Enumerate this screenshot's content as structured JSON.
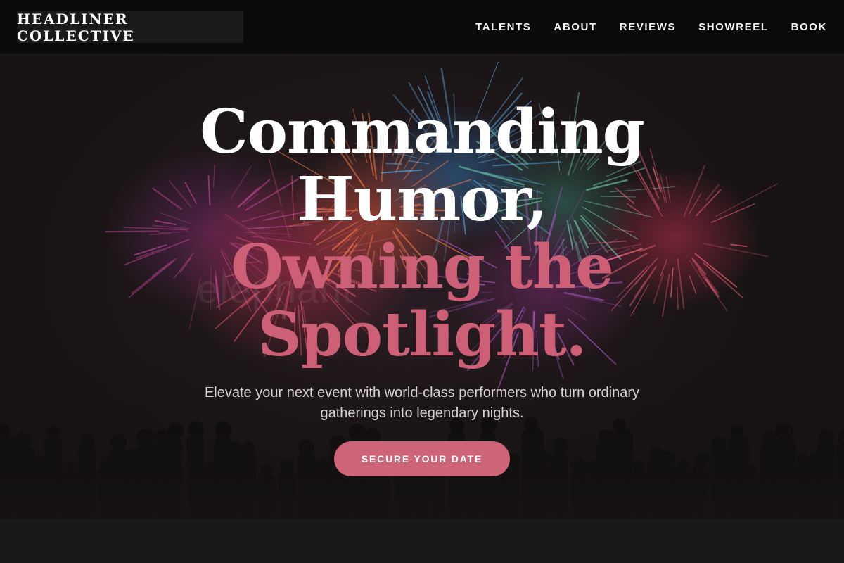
{
  "header": {
    "logo": "HEADLINER COLLECTIVE",
    "nav": [
      "TALENTS",
      "ABOUT",
      "REVIEWS",
      "SHOWREEL",
      "BOOK"
    ]
  },
  "hero": {
    "headline_lines": [
      "Commanding",
      "Humor,"
    ],
    "headline_accent_lines": [
      "Owning the",
      "Spotlight."
    ],
    "watermark": "elephant",
    "subtext": "Elevate your next event with world-class performers who turn ordinary gatherings into legendary nights.",
    "cta": "SECURE YOUR DATE",
    "background": "fireworks-over-crowd-image"
  },
  "colors": {
    "accent": "#cd5f76",
    "button": "#cd6477",
    "header_bg": "#0b0a0b",
    "page_bg": "#161415"
  }
}
